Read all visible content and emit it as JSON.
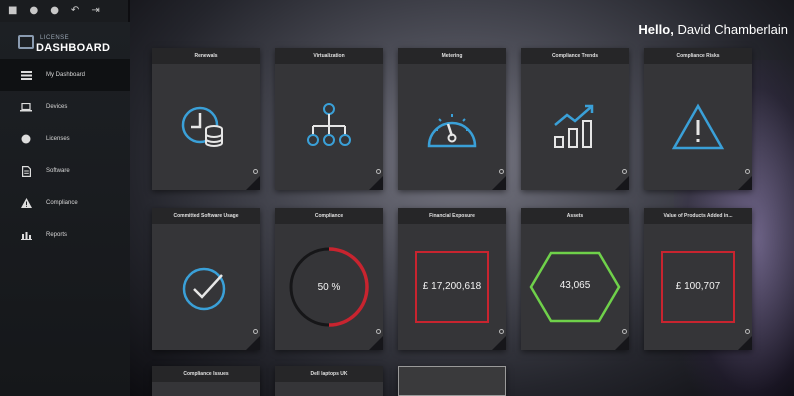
{
  "window": {
    "controls": [
      "■",
      "●",
      "●",
      "↶",
      "⇥"
    ]
  },
  "logo": {
    "small": "LICENSE",
    "big": "DASHBOARD"
  },
  "sidebar": {
    "items": [
      {
        "label": "My Dashboard",
        "icon": "list-icon",
        "active": true
      },
      {
        "label": "Devices",
        "icon": "laptop-icon"
      },
      {
        "label": "Licenses",
        "icon": "circle-icon"
      },
      {
        "label": "Software",
        "icon": "document-icon"
      },
      {
        "label": "Compliance",
        "icon": "warning-icon"
      },
      {
        "label": "Reports",
        "icon": "bar-chart-icon"
      }
    ]
  },
  "header": {
    "hello": "Hello,",
    "user": "David Chamberlain"
  },
  "tiles": [
    {
      "title": "Renewals",
      "icon": "clock-stack-icon"
    },
    {
      "title": "Virtualization",
      "icon": "hierarchy-icon"
    },
    {
      "title": "Metering",
      "icon": "gauge-icon"
    },
    {
      "title": "Compliance Trends",
      "icon": "trend-chart-icon"
    },
    {
      "title": "Compliance Risks",
      "icon": "warning-triangle-icon"
    },
    {
      "title": "Committed Software Usage",
      "icon": "checkmark-circle-icon"
    },
    {
      "title": "Compliance",
      "value": "50 %",
      "percent": 50
    },
    {
      "title": "Financial Exposure",
      "value": "£ 17,200,618"
    },
    {
      "title": "Assets",
      "value": "43,065"
    },
    {
      "title": "Value of Products Added in...",
      "value": "£ 100,707"
    },
    {
      "title": "Compliance Issues"
    },
    {
      "title": "Dell laptops UK"
    }
  ],
  "colors": {
    "accent_blue": "#3aa0d8",
    "alert_red": "#c8242f",
    "ok_green": "#6fd14a"
  }
}
